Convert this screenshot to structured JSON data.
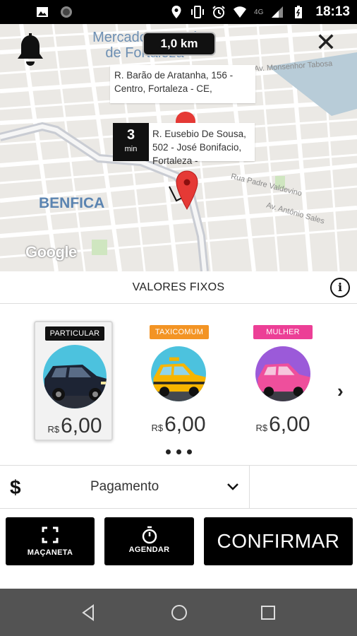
{
  "status_bar": {
    "network_label": "4G",
    "time": "18:13"
  },
  "map": {
    "area_label": "Mercado Central de Fortaleza",
    "neighborhood_label": "BENFICA",
    "street_labels": [
      "Av. Monsenhor Tabosa",
      "Rua Padre Valdevino",
      "Av. Antônio Sales"
    ],
    "distance": "1,0 km",
    "origin_address": "R. Barão de Aratanha, 156 - Centro, Fortaleza - CE,",
    "eta_value": "3",
    "eta_unit": "min",
    "destination_address": "R. Eusebio De Sousa, 502 - José Bonifacio, Fortaleza -",
    "attribution": "Google"
  },
  "fare_section": {
    "title": "VALORES FIXOS"
  },
  "vehicles": [
    {
      "badge": "PARTICULAR",
      "currency": "R$",
      "price": "6,00",
      "badge_color": "#111111",
      "badge_text_color": "#ffffff",
      "selected": true
    },
    {
      "badge": "TAXICOMUM",
      "currency": "R$",
      "price": "6,00",
      "badge_color": "#f39424",
      "badge_text_color": "#ffffff",
      "selected": false
    },
    {
      "badge": "MULHER",
      "currency": "R$",
      "price": "6,00",
      "badge_color": "#ec3f96",
      "badge_text_color": "#ffffff",
      "selected": false
    }
  ],
  "payment": {
    "label": "Pagamento"
  },
  "actions": {
    "doorman_label": "MAÇANETA",
    "schedule_label": "AGENDAR",
    "confirm_label": "CONFIRMAR"
  },
  "colors": {
    "primary": "#000000",
    "pin": "#e53935",
    "map_bg": "#ebe9e5"
  }
}
